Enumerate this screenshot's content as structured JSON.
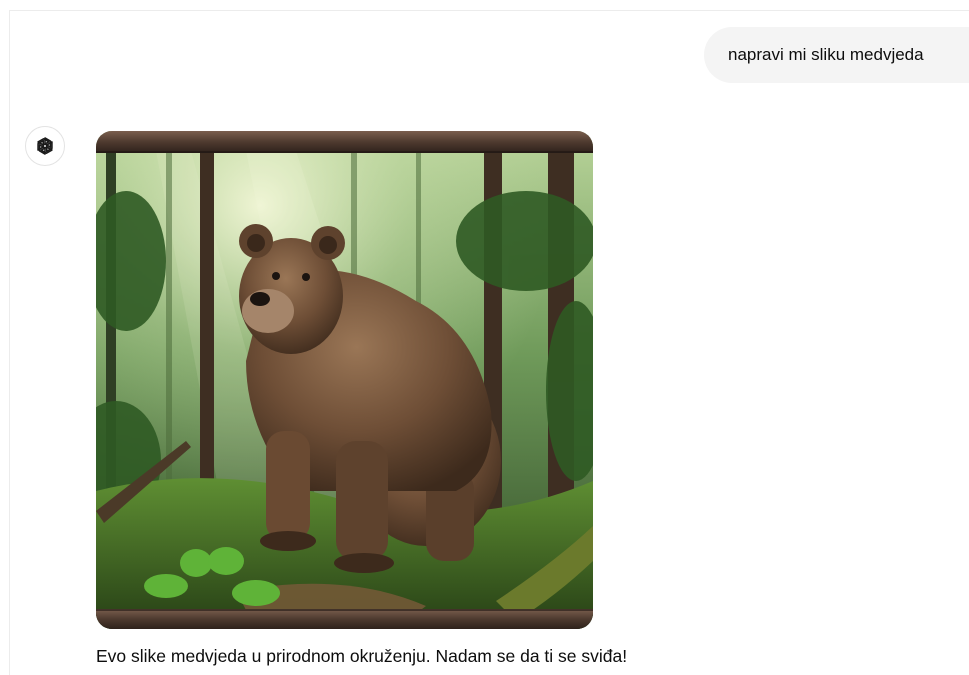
{
  "conversation": {
    "user_message": "napravi mi sliku medvjeda",
    "assistant": {
      "avatar_icon": "openai-logo-icon",
      "image_subject": "bear-in-forest",
      "reply": "Evo slike medvjeda u prirodnom okruženju. Nadam se da ti se sviđa!"
    }
  },
  "colors": {
    "user_bubble_bg": "#f4f4f4",
    "text": "#0d0d0d",
    "frame_wood": "#5a4438",
    "forest_light": "#cfe3b0",
    "bear_fur": "#6e4e36"
  }
}
